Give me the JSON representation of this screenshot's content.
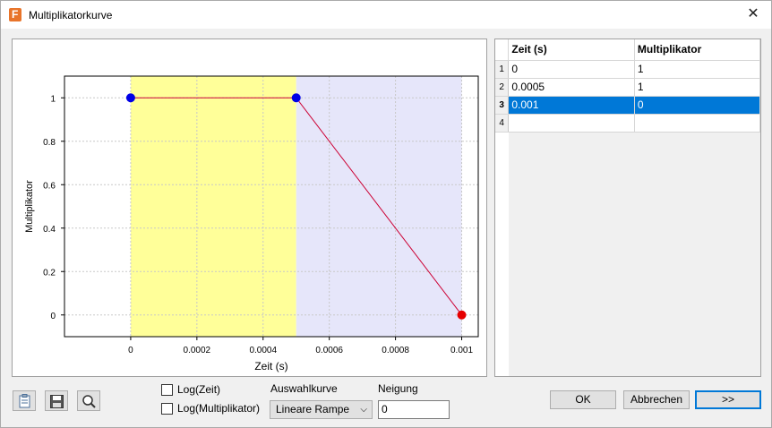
{
  "window": {
    "title": "Multiplikatorkurve",
    "close_glyph": "✕"
  },
  "chart_data": {
    "type": "line",
    "xlabel": "Zeit (s)",
    "ylabel": "Multiplikator",
    "xlim": [
      -0.0002,
      0.00105
    ],
    "ylim": [
      -0.1,
      1.1
    ],
    "x_ticks": [
      "0",
      "0.0002",
      "0.0004",
      "0.0006",
      "0.0008",
      "0.001"
    ],
    "y_ticks": [
      "0",
      "0.2",
      "0.4",
      "0.6",
      "0.8",
      "1"
    ],
    "grid": true,
    "regions": [
      {
        "x": [
          0,
          0.0005
        ],
        "color": "#ffff99"
      },
      {
        "x": [
          0.0005,
          0.001
        ],
        "color": "#e6e6fa"
      }
    ],
    "series": [
      {
        "x": [
          0,
          0.0005,
          0.001
        ],
        "y": [
          1,
          1,
          0
        ],
        "line_color": "#cc0033",
        "point_colors": [
          "#0000e6",
          "#0000e6",
          "#e60000"
        ]
      }
    ]
  },
  "table": {
    "columns": [
      "Zeit (s)",
      "Multiplikator"
    ],
    "rows": [
      {
        "num": "1",
        "zeit": "0",
        "mult": "1"
      },
      {
        "num": "2",
        "zeit": "0.0005",
        "mult": "1"
      },
      {
        "num": "3",
        "zeit": "0.001",
        "mult": "0"
      },
      {
        "num": "4",
        "zeit": "",
        "mult": ""
      }
    ],
    "selected_row": "3"
  },
  "controls": {
    "log_zeit_label": "Log(Zeit)",
    "log_mult_label": "Log(Multiplikator)",
    "curve_label": "Auswahlkurve",
    "curve_value": "Lineare Rampe",
    "slope_label": "Neigung",
    "slope_value": "0",
    "ok_label": "OK",
    "cancel_label": "Abbrechen",
    "expand_label": ">>"
  },
  "icons": [
    "app-icon",
    "close-icon",
    "clipboard-icon",
    "save-icon",
    "zoom-icon",
    "chevron-down-icon"
  ],
  "colors": {
    "selection": "#0078d7",
    "accent_border": "#0078d7"
  }
}
